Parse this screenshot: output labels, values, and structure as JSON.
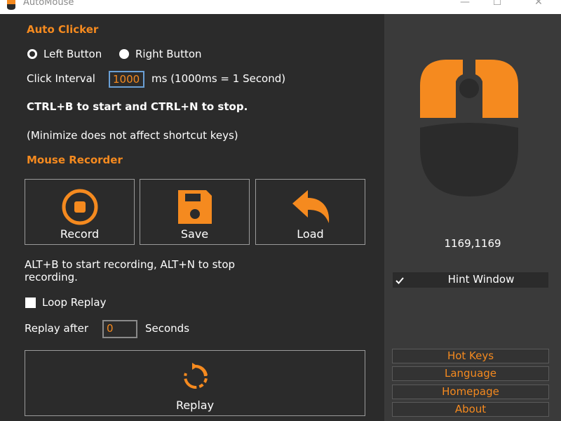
{
  "window": {
    "title": "AutoMouse",
    "minimize_glyph": "—",
    "maximize_glyph": "☐",
    "close_glyph": "✕"
  },
  "auto_clicker": {
    "title": "Auto Clicker",
    "left_button_label": "Left Button",
    "right_button_label": "Right Button",
    "selected": "left",
    "interval_label": "Click Interval",
    "interval_value": "1000",
    "interval_unit_note": "ms (1000ms = 1 Second)",
    "shortcut_text": "CTRL+B to start and CTRL+N to stop.",
    "minimize_note": "(Minimize does not affect shortcut keys)"
  },
  "mouse_recorder": {
    "title": "Mouse Recorder",
    "buttons": [
      {
        "label": "Record",
        "icon": "record-icon"
      },
      {
        "label": "Save",
        "icon": "save-icon"
      },
      {
        "label": "Load",
        "icon": "load-icon"
      }
    ],
    "hint_line1": "ALT+B to start recording, ALT+N to stop",
    "hint_line2": "recording.",
    "loop_replay_label": "Loop Replay",
    "loop_replay_checked": false,
    "replay_after_label": "Replay after",
    "replay_after_value": "0",
    "seconds_label": "Seconds",
    "replay_button_label": "Replay"
  },
  "side_panel": {
    "coordinates": "1169,1169",
    "hint_window_label": "Hint Window",
    "hint_window_checked": true,
    "nav": [
      "Hot Keys",
      "Language",
      "Homepage",
      "About"
    ]
  },
  "colors": {
    "accent": "#f58a1f",
    "background": "#2b2b2b",
    "side_background": "#3a3a3a"
  }
}
